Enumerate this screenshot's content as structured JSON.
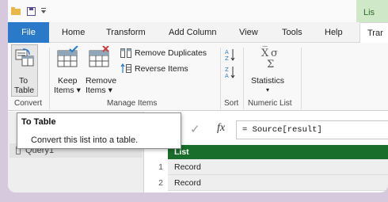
{
  "contextual_tab": {
    "label": "Lis"
  },
  "tabs": [
    {
      "label": "File"
    },
    {
      "label": "Home"
    },
    {
      "label": "Transform"
    },
    {
      "label": "Add Column"
    },
    {
      "label": "View"
    },
    {
      "label": "Tools"
    },
    {
      "label": "Help"
    },
    {
      "label": "Trar"
    }
  ],
  "ribbon": {
    "to_table": {
      "line1": "To",
      "line2": "Table"
    },
    "keep_items": {
      "line1": "Keep",
      "line2": "Items ▾"
    },
    "remove_items": {
      "line1": "Remove",
      "line2": "Items ▾"
    },
    "remove_duplicates": "Remove Duplicates",
    "reverse_items": "Reverse Items",
    "statistics": {
      "label": "Statistics",
      "caret": "▾"
    },
    "groups": {
      "convert": "Convert",
      "manage_items": "Manage Items",
      "sort": "Sort",
      "numeric_list": "Numeric List"
    }
  },
  "tooltip": {
    "title": "To Table",
    "description": "Convert this list into a table."
  },
  "queries": {
    "item": "Query1"
  },
  "formula_bar": {
    "cancel_glyph": "✓",
    "fx": "fx",
    "formula": "= Source[result]"
  },
  "grid": {
    "column_header": "List",
    "rows": [
      {
        "num": "1",
        "value": "Record"
      },
      {
        "num": "2",
        "value": "Record"
      }
    ]
  },
  "colors": {
    "file_tab": "#2b79c9",
    "column_header": "#1a6e2c",
    "contextual_tab": "#cfe8c7"
  }
}
